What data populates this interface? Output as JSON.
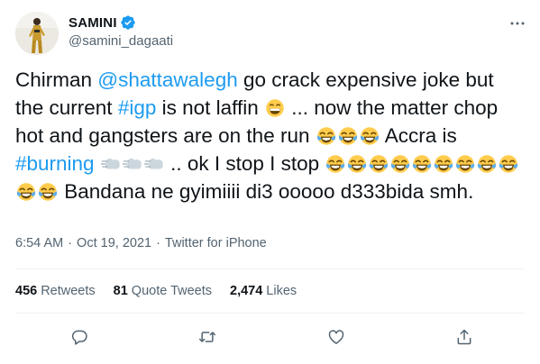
{
  "user": {
    "display_name": "SAMINI",
    "handle": "@samini_dagaati",
    "verified": true
  },
  "tweet": {
    "segments": [
      {
        "t": "Chirman "
      },
      {
        "t": "@shattawalegh",
        "link": true
      },
      {
        "t": " go crack expensive joke but the current "
      },
      {
        "t": "#igp",
        "link": true
      },
      {
        "t": " is not laffin "
      },
      {
        "emoji": "grinning-face",
        "count": 1
      },
      {
        "t": " ... now the matter chop hot and gangsters are on the run "
      },
      {
        "emoji": "tears-of-joy",
        "count": 3
      },
      {
        "t": " Accra is "
      },
      {
        "t": "#burning",
        "link": true
      },
      {
        "t": " "
      },
      {
        "emoji": "dash",
        "count": 3
      },
      {
        "t": " .. ok I stop I stop "
      },
      {
        "emoji": "tears-of-joy",
        "count": 11
      },
      {
        "t": " Bandana ne gyimiiii di3 ooooo d333bida smh."
      }
    ]
  },
  "meta": {
    "time": "6:54 AM",
    "date": "Oct 19, 2021",
    "separator": "·",
    "source": "Twitter for iPhone"
  },
  "stats": {
    "retweets_count": "456",
    "retweets_label": "Retweets",
    "quotes_count": "81",
    "quotes_label": "Quote Tweets",
    "likes_count": "2,474",
    "likes_label": "Likes"
  },
  "icons": {
    "verified": "verified-badge-icon",
    "more": "more-options-icon",
    "reply": "reply-icon",
    "retweet": "retweet-icon",
    "like": "like-icon",
    "share": "share-icon"
  },
  "colors": {
    "link": "#1d9bf0",
    "secondary_text": "#536471",
    "primary_text": "#0f1419",
    "divider": "#eff3f4"
  }
}
